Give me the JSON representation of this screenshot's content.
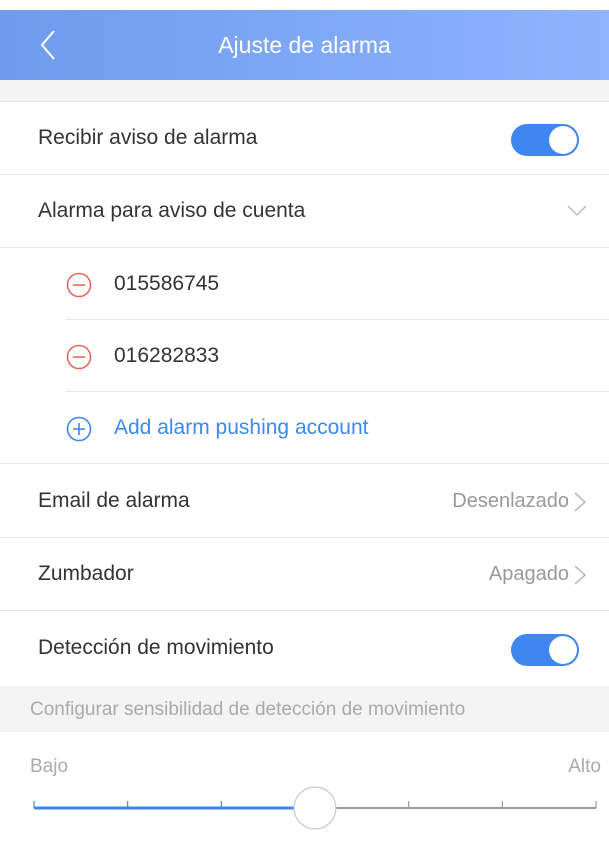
{
  "header": {
    "title": "Ajuste de alarma",
    "back_icon": "chevron-left-icon"
  },
  "receive_alarm": {
    "label": "Recibir aviso de alarma",
    "enabled": true
  },
  "account_alarm": {
    "label": "Alarma para aviso de cuenta",
    "accounts": [
      "015586745",
      "016282833"
    ],
    "add_label": "Add alarm pushing account"
  },
  "email": {
    "label": "Email de alarma",
    "value": "Desenlazado"
  },
  "buzzer": {
    "label": "Zumbador",
    "value": "Apagado"
  },
  "motion": {
    "label": "Detección de movimiento",
    "enabled": true
  },
  "sensitivity": {
    "section_title": "Configurar sensibilidad de detección de movimiento",
    "low_label": "Bajo",
    "high_label": "Alto",
    "level_fraction": 0.5
  },
  "colors": {
    "accent": "#3f86f0",
    "remove": "#e8685f",
    "header_start": "#6d9cec",
    "header_end": "#8fb3ff"
  }
}
